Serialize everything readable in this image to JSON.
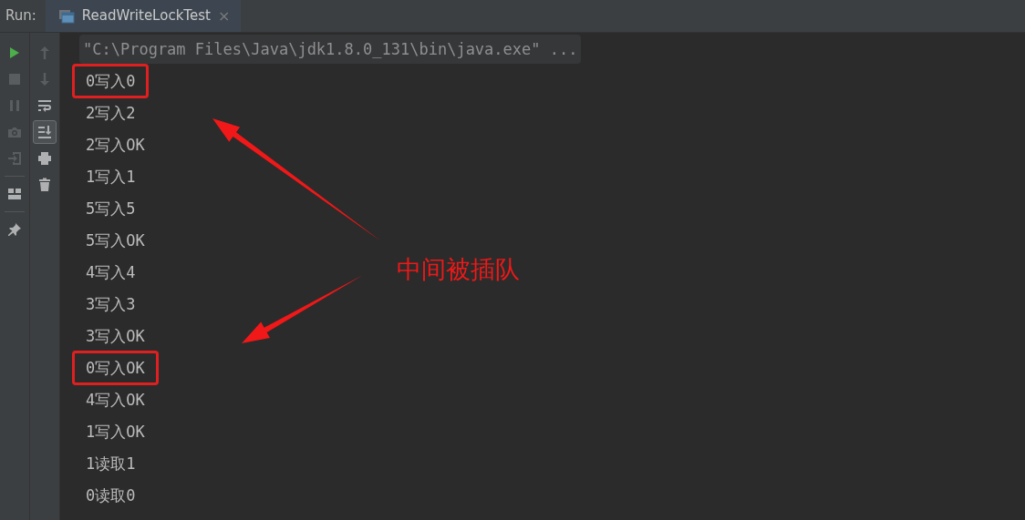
{
  "run_panel": {
    "label": "Run:",
    "tabs": [
      {
        "title": "ReadWriteLockTest",
        "close": "×",
        "selected": true
      }
    ]
  },
  "left_toolbar": [
    {
      "kind": "run",
      "disabled": false
    },
    {
      "kind": "stop",
      "disabled": true
    },
    {
      "kind": "pause",
      "disabled": true
    },
    {
      "kind": "camera",
      "disabled": true
    },
    {
      "kind": "enter",
      "disabled": true
    },
    {
      "kind": "divider"
    },
    {
      "kind": "layout",
      "disabled": false
    },
    {
      "kind": "divider"
    },
    {
      "kind": "pin",
      "disabled": false
    }
  ],
  "right_toolbar": [
    {
      "kind": "up",
      "disabled": true,
      "selected": false
    },
    {
      "kind": "down",
      "disabled": true,
      "selected": false
    },
    {
      "kind": "wrap",
      "disabled": false,
      "selected": false
    },
    {
      "kind": "scroll",
      "disabled": false,
      "selected": true
    },
    {
      "kind": "print",
      "disabled": false,
      "selected": false
    },
    {
      "kind": "trash",
      "disabled": false,
      "selected": false
    }
  ],
  "console": [
    {
      "text": "\"C:\\Program Files\\Java\\jdk1.8.0_131\\bin\\java.exe\" ...",
      "kind": "command"
    },
    {
      "text": "0写入0",
      "kind": "output",
      "boxed": true
    },
    {
      "text": "2写入2",
      "kind": "output",
      "boxed": false
    },
    {
      "text": "2写入OK",
      "kind": "output",
      "boxed": false
    },
    {
      "text": "1写入1",
      "kind": "output",
      "boxed": false
    },
    {
      "text": "5写入5",
      "kind": "output",
      "boxed": false
    },
    {
      "text": "5写入OK",
      "kind": "output",
      "boxed": false
    },
    {
      "text": "4写入4",
      "kind": "output",
      "boxed": false
    },
    {
      "text": "3写入3",
      "kind": "output",
      "boxed": false
    },
    {
      "text": "3写入OK",
      "kind": "output",
      "boxed": false
    },
    {
      "text": "0写入OK",
      "kind": "output",
      "boxed": true
    },
    {
      "text": "4写入OK",
      "kind": "output",
      "boxed": false
    },
    {
      "text": "1写入OK",
      "kind": "output",
      "boxed": false
    },
    {
      "text": "1读取1",
      "kind": "output",
      "boxed": false
    },
    {
      "text": "0读取0",
      "kind": "output",
      "boxed": false
    }
  ],
  "annotation": {
    "text": "中间被插队"
  }
}
